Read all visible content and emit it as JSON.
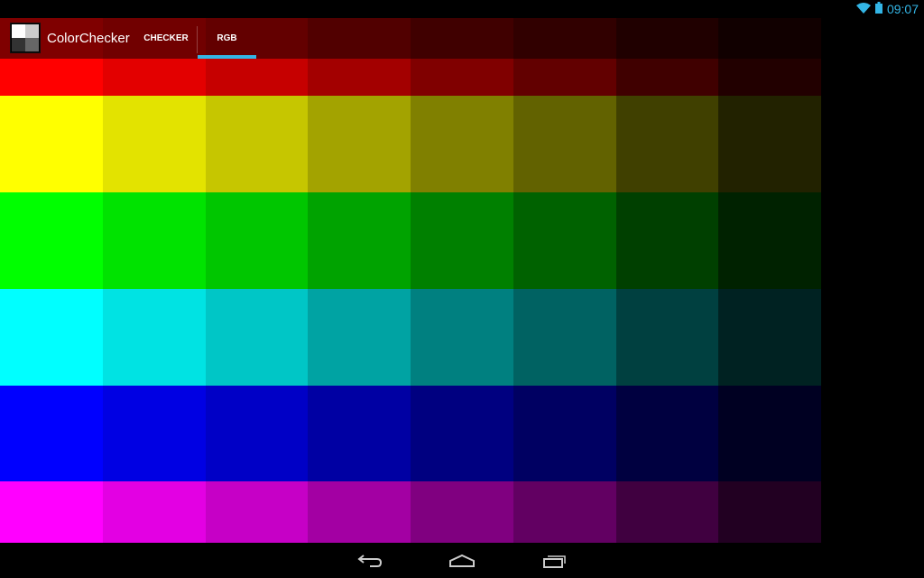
{
  "status_bar": {
    "time": "09:07",
    "icons": [
      "wifi-icon",
      "battery-icon"
    ],
    "accent": "#33b5e5"
  },
  "action_bar": {
    "title": "ColorChecker",
    "tabs": [
      {
        "label": "CHECKER",
        "selected": false
      },
      {
        "label": "RGB",
        "selected": true
      }
    ]
  },
  "grid": {
    "levels": [
      255,
      227,
      198,
      163,
      128,
      98,
      64,
      34
    ],
    "rows": [
      {
        "name": "red",
        "rgb": [
          1,
          0,
          0
        ]
      },
      {
        "name": "yellow",
        "rgb": [
          1,
          1,
          0
        ]
      },
      {
        "name": "green",
        "rgb": [
          0,
          1,
          0
        ]
      },
      {
        "name": "cyan",
        "rgb": [
          0,
          1,
          1
        ]
      },
      {
        "name": "blue",
        "rgb": [
          0,
          0,
          1
        ]
      },
      {
        "name": "magenta",
        "rgb": [
          1,
          0,
          1
        ]
      }
    ]
  },
  "nav_bar": {
    "buttons": [
      "back",
      "home",
      "recent-apps"
    ]
  }
}
